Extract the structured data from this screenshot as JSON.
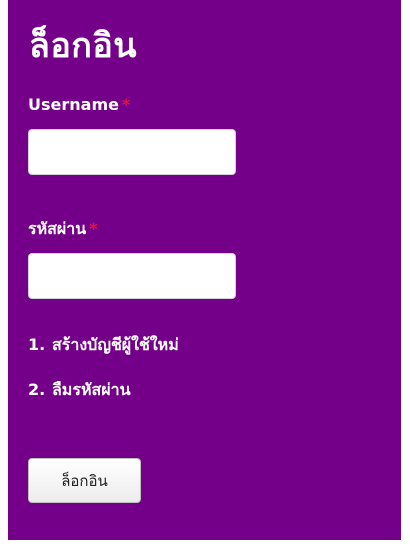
{
  "login": {
    "title": "ล็อกอิน",
    "username_label": "Username",
    "password_label": "รหัสผ่าน",
    "required_mark": "*",
    "username_value": "",
    "password_value": "",
    "links": [
      {
        "number": "1.",
        "label": "สร้างบัญชีผู้ใช้ใหม่"
      },
      {
        "number": "2.",
        "label": "ลืมรหัสผ่าน"
      }
    ],
    "submit_label": "ล็อกอิน"
  },
  "colors": {
    "panel_background": "#74008a",
    "required_mark": "#e8133c",
    "text": "#ffffff"
  }
}
